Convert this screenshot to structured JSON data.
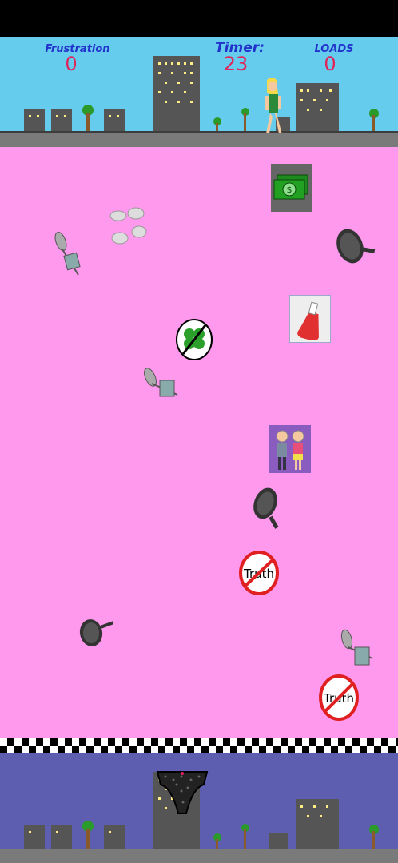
{
  "hud": {
    "frustration_label": "Frustration",
    "frustration_value": "0",
    "timer_label": "Timer:",
    "timer_value": "23",
    "loads_label": "LOADS",
    "loads_value": "0"
  },
  "items": {
    "truth_sign_text": "Truth"
  },
  "icons": [
    "money-icon",
    "clouds-icon",
    "net-bucket-icon",
    "frying-pan-icon",
    "ketchup-bottle-icon",
    "broken-clover-icon",
    "old-couple-icon",
    "no-truth-icon",
    "underwear-icon",
    "player-woman-icon"
  ],
  "colors": {
    "sky": "#66ccee",
    "field": "#ff99ee",
    "bottom": "#5e5eb0",
    "hud_label": "#2233cc",
    "hud_value": "#e0245a"
  }
}
